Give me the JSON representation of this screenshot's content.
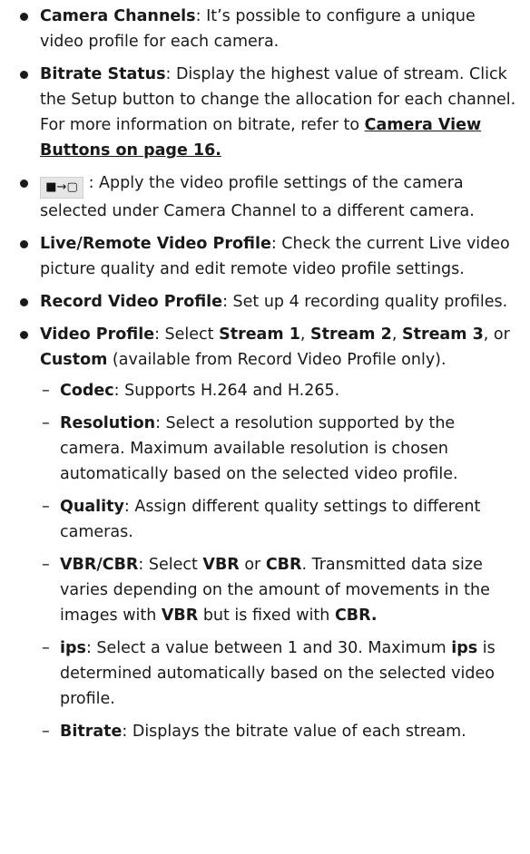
{
  "items": [
    {
      "term": "Camera Channels",
      "text": ": It’s possible to configure a unique video profile for each camera."
    },
    {
      "term": "Bitrate Status",
      "text": ": Display the highest value of stream. Click the Setup button to change the allocation for each channel. For more information on bitrate, refer to ",
      "link": "Camera View Buttons on page 16."
    },
    {
      "icon": "■→▢",
      "text": " : Apply the video profile settings of the camera selected under Camera Channel to a different camera."
    },
    {
      "term": "Live/Remote Video Profile",
      "text": ": Check the current Live video picture quality and edit remote video profile settings."
    },
    {
      "term": "Record Video Profile",
      "text": ": Set up 4 recording quality profiles."
    }
  ],
  "video_profile": {
    "term": "Video Profile",
    "t1": ": Select ",
    "s1": "Stream 1",
    "sep1": ", ",
    "s2": "Stream 2",
    "sep2": ", ",
    "s3": "Stream 3",
    "sep3": ", or ",
    "s4": "Custom",
    "t2": " (available from Record Video Profile only)."
  },
  "sub_items": [
    {
      "term": "Codec",
      "text": ": Supports H.264 and H.265."
    },
    {
      "term": "Resolution",
      "text": ": Select a resolution supported by the camera. Maximum available resolution is chosen automatically based on the selected video profile."
    },
    {
      "term": "Quality",
      "text": ": Assign different quality settings to different cameras."
    }
  ],
  "vbr": {
    "term": "VBR/CBR",
    "t1": ": Select ",
    "b1": "VBR",
    "t2": " or ",
    "b2": "CBR",
    "t3": ". Transmitted data size varies depending on the amount of movements in the images with ",
    "b3": "VBR",
    "t4": " but is fixed with ",
    "b4": "CBR."
  },
  "ips": {
    "term": "ips",
    "t1": ": Select a value between 1 and 30. Maximum ",
    "b1": "ips",
    "t2": " is determined automatically based on the selected video profile."
  },
  "bitrate": {
    "term": "Bitrate",
    "text": ": Displays the bitrate value of each stream."
  }
}
